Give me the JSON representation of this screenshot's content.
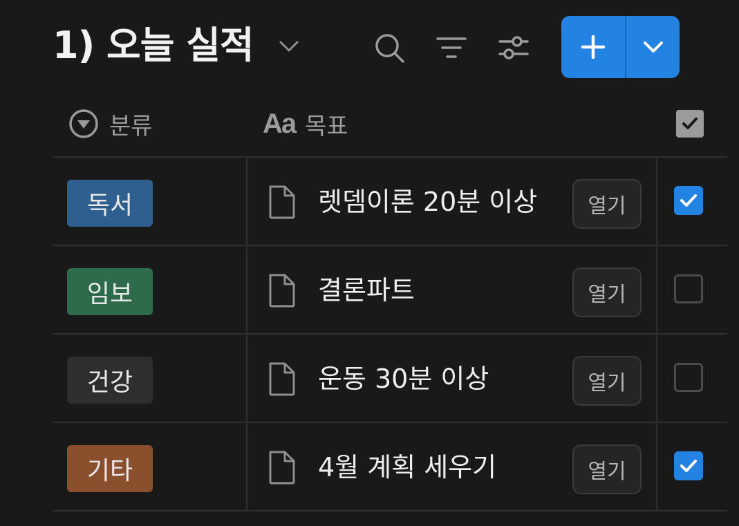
{
  "header": {
    "title": "1) 오늘 실적",
    "icons": [
      "chevron-down-icon",
      "search-icon",
      "filter-icon",
      "sliders-icon",
      "plus-icon"
    ]
  },
  "columns": {
    "category": "분류",
    "goal": "목표",
    "goal_icon_glyph": "Aa"
  },
  "rows": [
    {
      "tag": "독서",
      "tag_color": "#2f5f8f",
      "goal": "렛뎀이론 20분 이상",
      "open_label": "열기",
      "checked": true
    },
    {
      "tag": "임보",
      "tag_color": "#2d6b4a",
      "goal": "결론파트",
      "open_label": "열기",
      "checked": false
    },
    {
      "tag": "건강",
      "tag_color": "#2e2e2e",
      "goal": "운동 30분 이상",
      "open_label": "열기",
      "checked": false
    },
    {
      "tag": "기타",
      "tag_color": "#8a4f2c",
      "goal": "4월 계획 세우기",
      "open_label": "열기",
      "checked": true
    }
  ],
  "colors": {
    "background": "#191919",
    "accent": "#2383e2",
    "grid": "#2f2f2f",
    "muted_text": "#9b9b9b"
  }
}
